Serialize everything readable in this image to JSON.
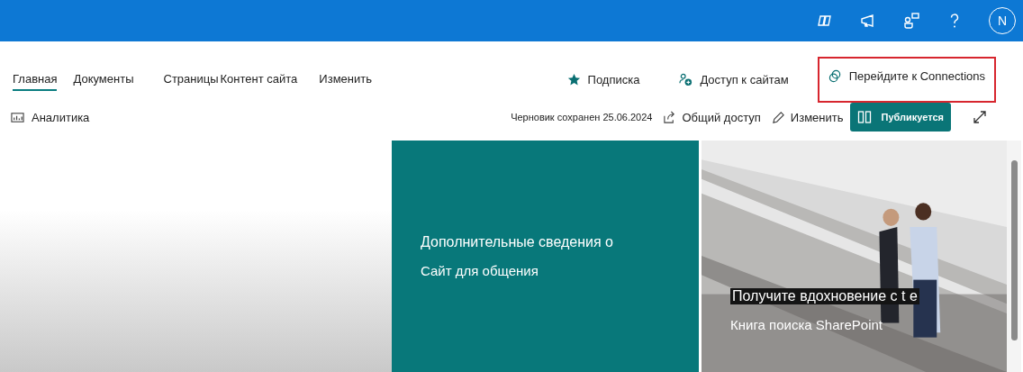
{
  "top_bar": {
    "avatar": "N"
  },
  "nav": {
    "tabs": [
      {
        "label": "Главная",
        "selected": true
      },
      {
        "label": "Документы",
        "selected": false
      },
      {
        "label": "Страницы",
        "selected": false
      },
      {
        "label": "Контент сайта",
        "selected": false
      },
      {
        "label": "Изменить",
        "selected": false
      }
    ],
    "actions": [
      {
        "kind": "star",
        "label": "Подписка",
        "highlighted": false
      },
      {
        "kind": "people",
        "label": "Доступ к сайтам",
        "highlighted": false
      },
      {
        "kind": "connections",
        "label": "Перейдите к Connections",
        "highlighted": true
      }
    ]
  },
  "command_bar": {
    "analytics": "Аналитика",
    "draft_status": "Черновик сохранен 25.06.2024",
    "share": "Общий доступ",
    "edit": "Изменить",
    "publish": "Публикуется"
  },
  "tiles": [
    {
      "kind": "teal",
      "title": "Дополнительные сведения о",
      "subtitle": "Сайт для общения"
    },
    {
      "kind": "picture",
      "title": "Получите вдохновение с t e",
      "subtitle": "Книга поиска SharePoint"
    }
  ]
}
